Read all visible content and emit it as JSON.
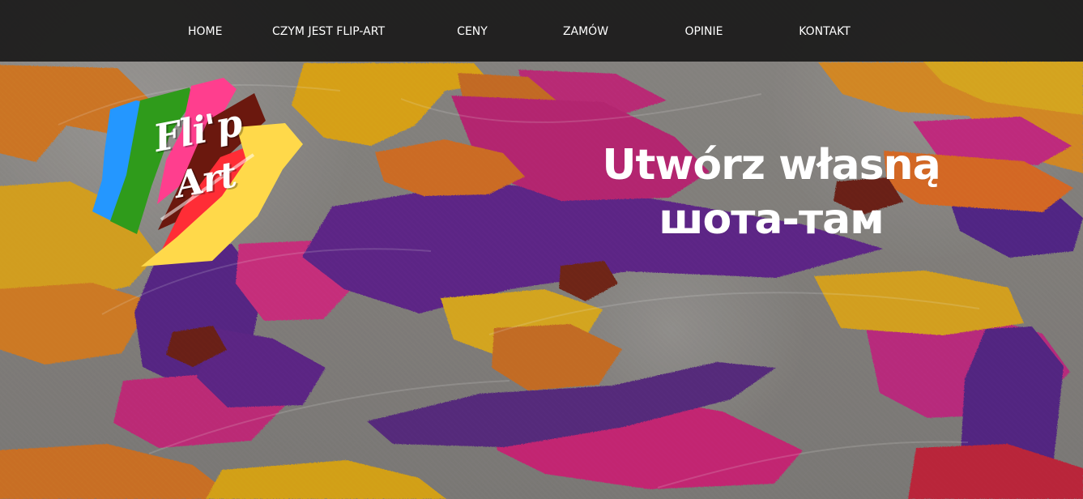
{
  "nav": {
    "items": [
      {
        "label": "HOME"
      },
      {
        "label": "CZYM JEST FLIP-ART"
      },
      {
        "label": "CENY"
      },
      {
        "label": "ZAMÓW"
      },
      {
        "label": "OPINIE"
      },
      {
        "label": "KONTAKT"
      }
    ]
  },
  "logo": {
    "line_1": "Fli'p",
    "line_2": "Art"
  },
  "hero": {
    "title_line_1": "Utwórz własną",
    "title_line_2": "шота-там"
  },
  "colors": {
    "nav_bg": "#121212",
    "text": "#ffffff",
    "orange": "#dd7a19",
    "gold": "#e1ac12",
    "purple": "#5b1f8b",
    "magenta": "#c81d7c",
    "red": "#d92534",
    "blue": "#2497ff",
    "green": "#2f9b1b",
    "yellow": "#ffd94a",
    "pink": "#ff3e8e",
    "dark_red": "#6b180e",
    "background_gray": "#807d7a"
  }
}
